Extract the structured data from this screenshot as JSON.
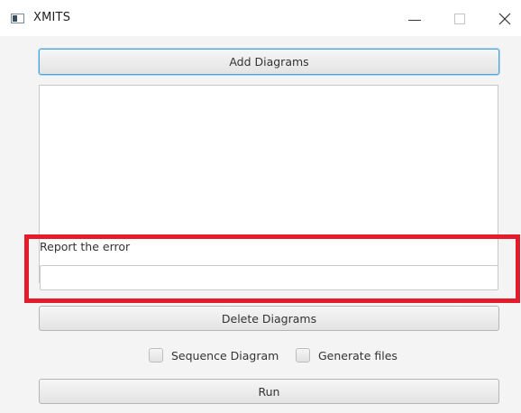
{
  "window": {
    "title": "XMITS"
  },
  "toolbar": {
    "add_label": "Add Diagrams",
    "delete_label": "Delete Diagrams",
    "run_label": "Run"
  },
  "diagram_list": {
    "items": []
  },
  "report": {
    "label": "Report the error",
    "value": "",
    "placeholder": ""
  },
  "options": {
    "sequence_label": "Sequence Diagram",
    "sequence_checked": false,
    "generate_label": "Generate files",
    "generate_checked": false
  },
  "colors": {
    "highlight": "#e31b2a",
    "focus_border": "#4fa6d8"
  }
}
